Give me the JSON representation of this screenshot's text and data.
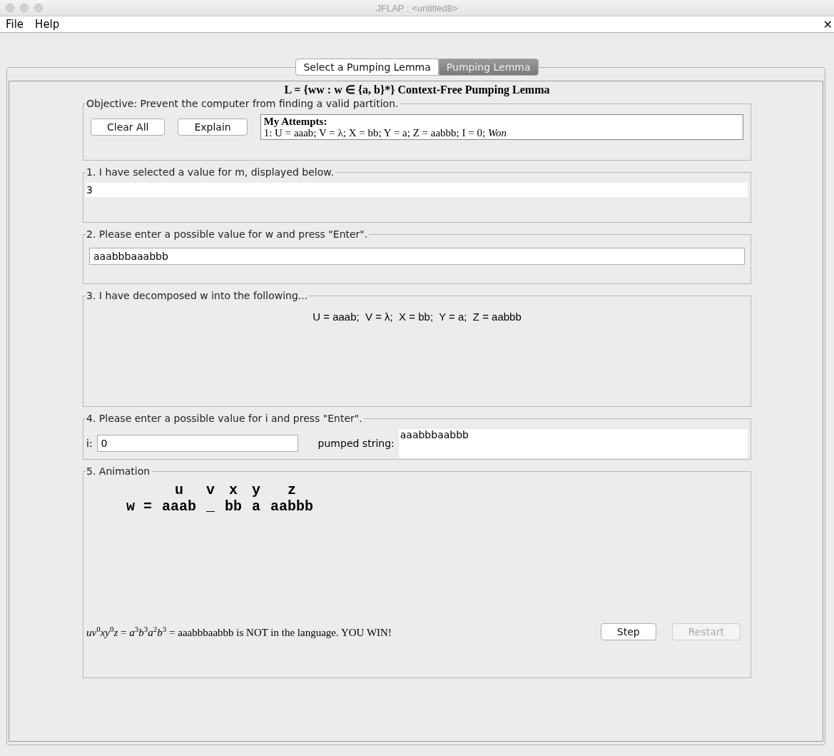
{
  "window": {
    "title": "JFLAP : <untitled8>"
  },
  "menu": [
    "File",
    "Help"
  ],
  "close_label": "✕",
  "tabs": [
    {
      "label": "Select a Pumping Lemma",
      "selected": false
    },
    {
      "label": "Pumping Lemma",
      "selected": true
    }
  ],
  "heading": "L = {ww : w ∈ {a, b}*} Context-Free Pumping Lemma",
  "objective": {
    "title": "Objective: Prevent the computer from finding a valid partition.",
    "buttons": [
      "Clear All",
      "Explain"
    ],
    "attempts_title": "My Attempts:",
    "attempts": [
      "1: U = aaab; V = λ; X = bb; Y = a; Z = aabbb; I = 0; *Won*"
    ]
  },
  "step1": {
    "title": "1. I have selected a value for m, displayed below.",
    "value": "3"
  },
  "step2": {
    "title": "2. Please enter a possible value for w and press \"Enter\".",
    "value": "aaabbbaaabbb"
  },
  "step3": {
    "title": "3. I have decomposed w into the following...",
    "decomposition": "U = aaab;  V = λ;  X = bb;  Y = a;  Z = aabbb"
  },
  "step4": {
    "title": "4. Please enter a possible value for i and press \"Enter\".",
    "i_label": "i:",
    "i_value": "0",
    "pumped_label": "pumped string:",
    "pumped_value": "aaabbbaabbb"
  },
  "step5": {
    "title": "5. Animation",
    "prefix": "w =",
    "parts": [
      {
        "label": "u",
        "text": "aaab"
      },
      {
        "label": "v",
        "text": "_"
      },
      {
        "label": "x",
        "text": "bb"
      },
      {
        "label": "y",
        "text": "a"
      },
      {
        "label": "z",
        "text": "aabbb"
      }
    ],
    "result": "*uv*$^{0}$*xy*$^{0}$*z* = *a*$^{3}$*b*$^{3}$*a*$^{2}$*b*$^{3}$ = aaabbbaabbb is NOT in the language. YOU WIN!",
    "buttons": [
      {
        "label": "Step",
        "disabled": false
      },
      {
        "label": "Restart",
        "disabled": true
      }
    ]
  }
}
